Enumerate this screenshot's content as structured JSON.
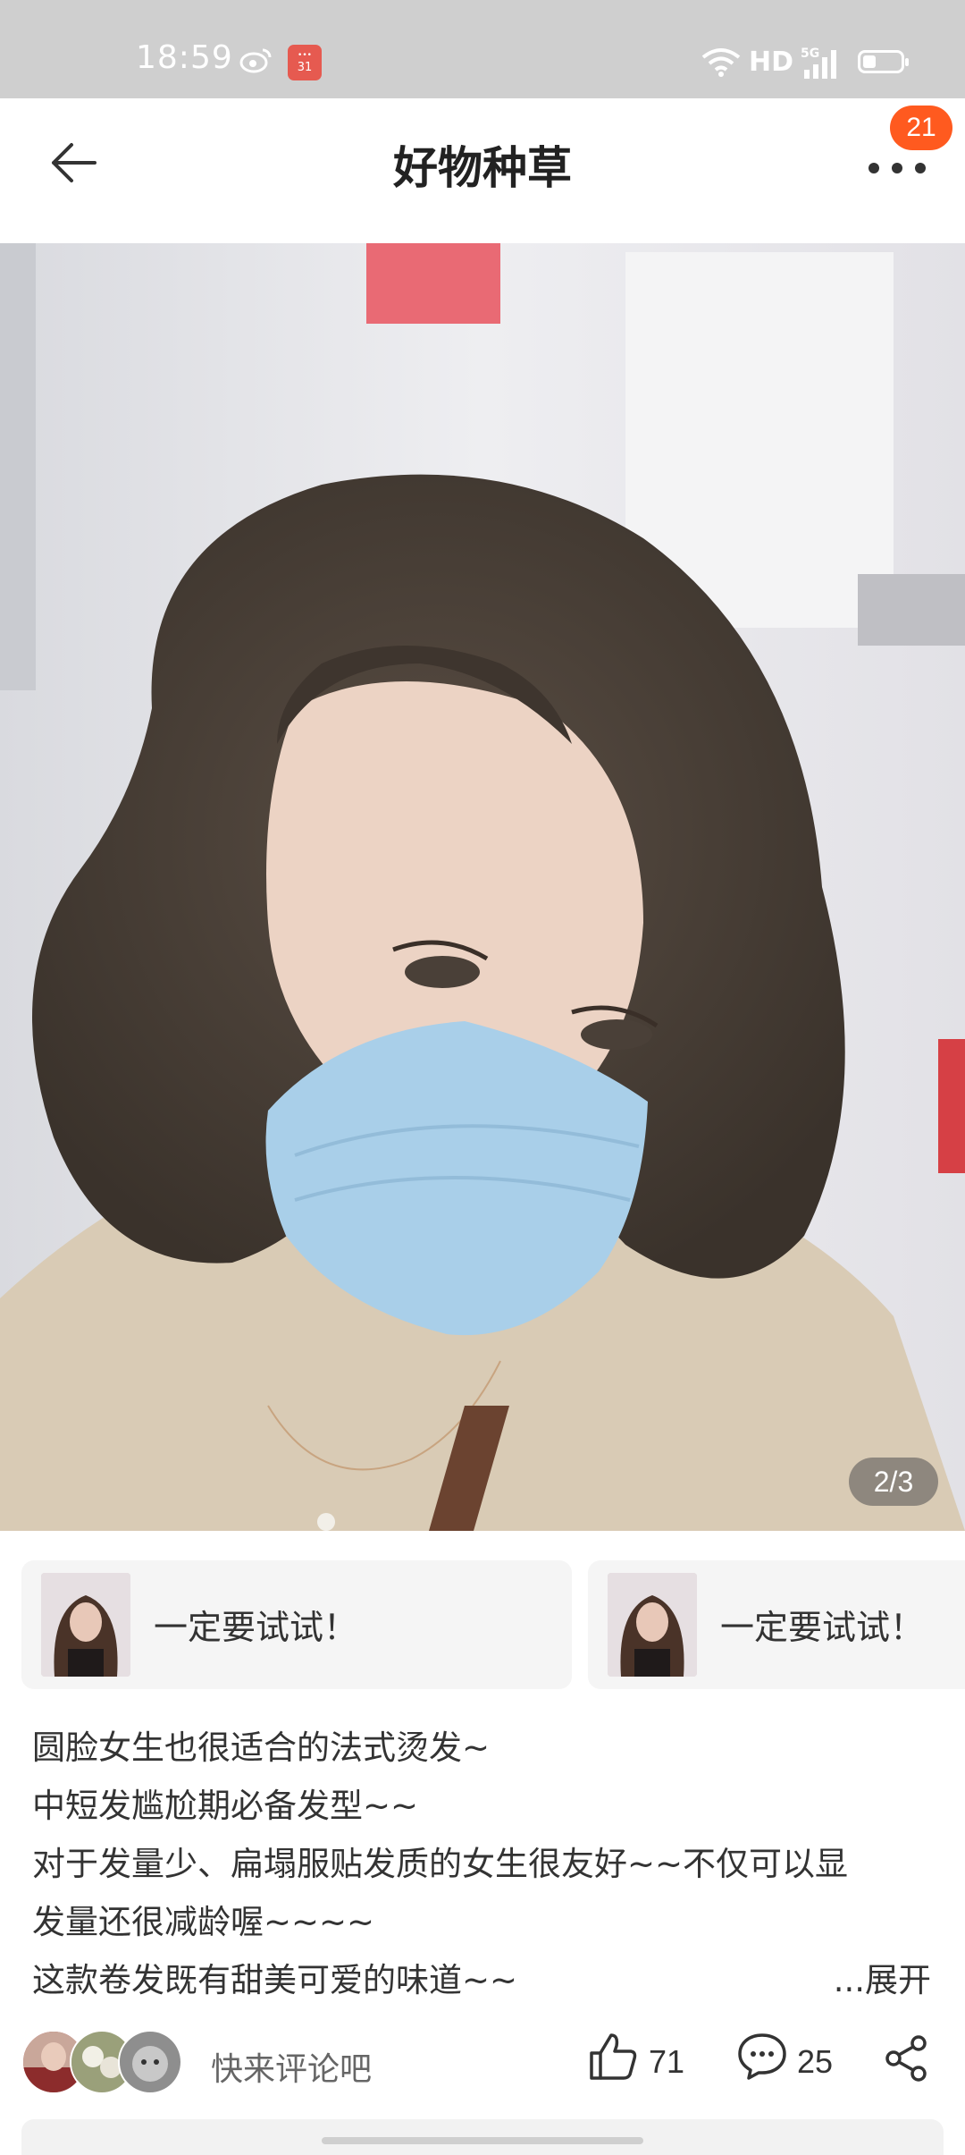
{
  "status_bar": {
    "time": "18:59",
    "calendar_icon_text": "31",
    "network_hd": "HD",
    "network_5g": "5G",
    "icons": [
      "weibo-icon",
      "calendar-icon",
      "wifi-icon",
      "signal-icon",
      "battery-icon"
    ]
  },
  "header": {
    "title": "好物种草",
    "notification_badge": "21",
    "icons": [
      "back-arrow-icon",
      "more-dots-icon"
    ]
  },
  "photo": {
    "page_indicator": "2/3"
  },
  "product_cards": [
    {
      "label": "一定要试试！"
    },
    {
      "label": "一定要试试！"
    }
  ],
  "description": {
    "lines": [
      "圆脸女生也很适合的法式烫发~",
      "中短发尴尬期必备发型~~",
      "对于发量少、扁塌服贴发质的女生很友好~~不仅可以显",
      "发量还很减龄喔~~~~",
      "这款卷发既有甜美可爱的味道~~"
    ],
    "expand_label": "...展开"
  },
  "actions": {
    "comment_prompt": "快来评论吧",
    "like_count": "71",
    "comment_count": "25",
    "icons": [
      "like-icon",
      "comment-icon",
      "share-icon"
    ]
  },
  "colors": {
    "accent": "#ff5a1f",
    "status_bar": "#cfcfcf",
    "card_bg": "#f5f5f5"
  }
}
